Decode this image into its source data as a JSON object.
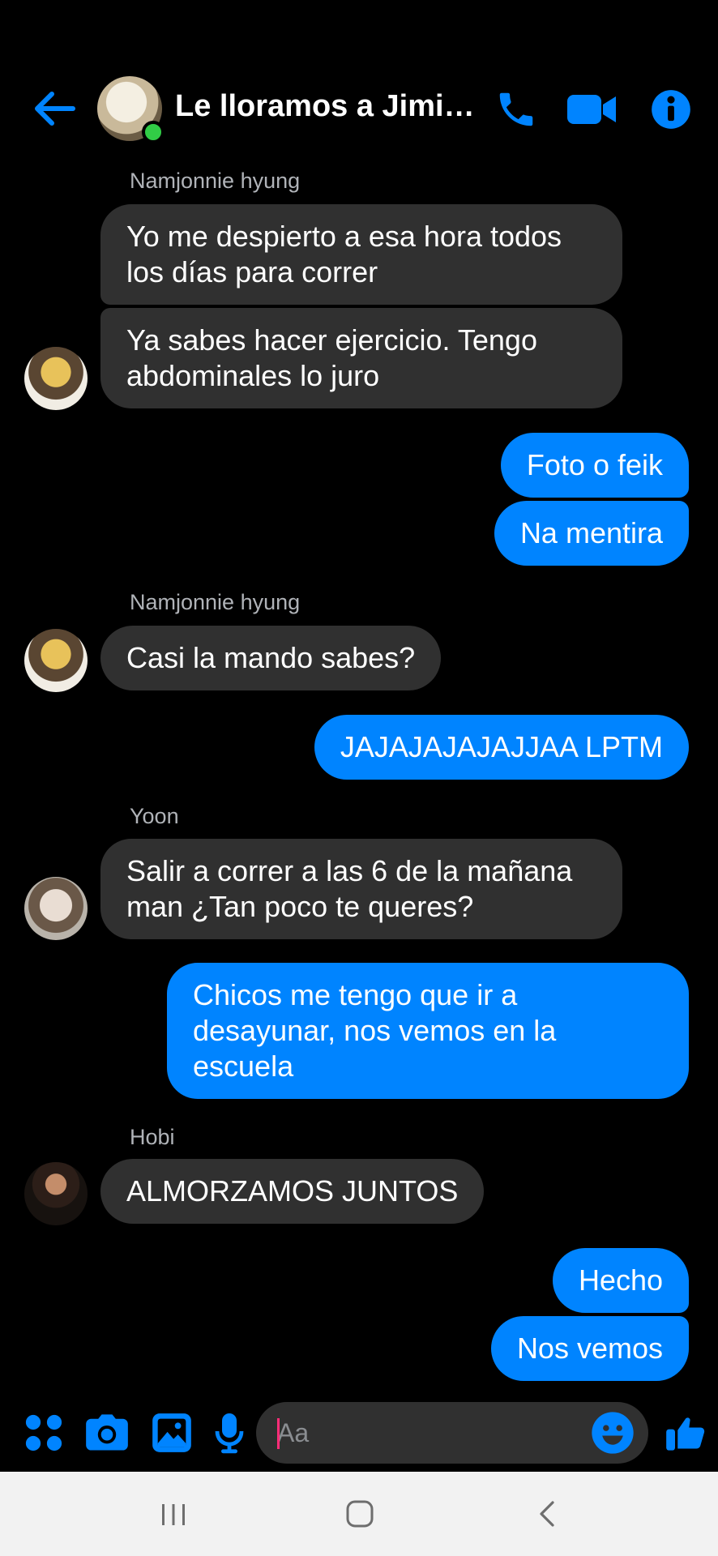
{
  "header": {
    "title": "Le lloramos a Jimi…",
    "icons": [
      "back-arrow-icon",
      "phone-icon",
      "video-camera-icon",
      "info-icon"
    ]
  },
  "colors": {
    "accent": "#0084ff",
    "incoming_bubble": "#303030",
    "background": "#000000",
    "online": "#31cc46",
    "cursor": "#ff2d78"
  },
  "messages": [
    {
      "id": "m1",
      "from": "Namjonnie hyung",
      "direction": "in",
      "text": "Yo me despierto a esa hora todos los días para correr"
    },
    {
      "id": "m2",
      "from": "Namjonnie hyung",
      "direction": "in",
      "text": "Ya sabes hacer ejercicio. Tengo abdominales lo juro"
    },
    {
      "id": "m3",
      "direction": "out",
      "text": "Foto o feik"
    },
    {
      "id": "m4",
      "direction": "out",
      "text": "Na mentira"
    },
    {
      "id": "m5",
      "from": "Namjonnie hyung",
      "direction": "in",
      "text": "Casi la mando sabes?"
    },
    {
      "id": "m6",
      "direction": "out",
      "text": "JAJAJAJAJAJJAA LPTM"
    },
    {
      "id": "m7",
      "from": "Yoon",
      "direction": "in",
      "text": "Salir a correr a las 6 de la mañana man ¿Tan poco te queres?"
    },
    {
      "id": "m8",
      "direction": "out",
      "text": "Chicos me tengo que ir a desayunar, nos vemos en la escuela"
    },
    {
      "id": "m9",
      "from": "Hobi",
      "direction": "in",
      "text": "ALMORZAMOS JUNTOS"
    },
    {
      "id": "m10",
      "direction": "out",
      "text": "Hecho"
    },
    {
      "id": "m11",
      "direction": "out",
      "text": "Nos vemos"
    }
  ],
  "senders": {
    "namjoon_1": "Namjonnie hyung",
    "namjoon_2": "Namjonnie hyung",
    "yoon": "Yoon",
    "hobi": "Hobi"
  },
  "composer": {
    "placeholder": "Aa",
    "icons": [
      "apps-grid-icon",
      "camera-icon",
      "gallery-icon",
      "microphone-icon",
      "emoji-icon",
      "thumbs-up-icon"
    ]
  },
  "navbar": {
    "icons": [
      "recent-apps-icon",
      "home-icon",
      "back-icon"
    ]
  }
}
